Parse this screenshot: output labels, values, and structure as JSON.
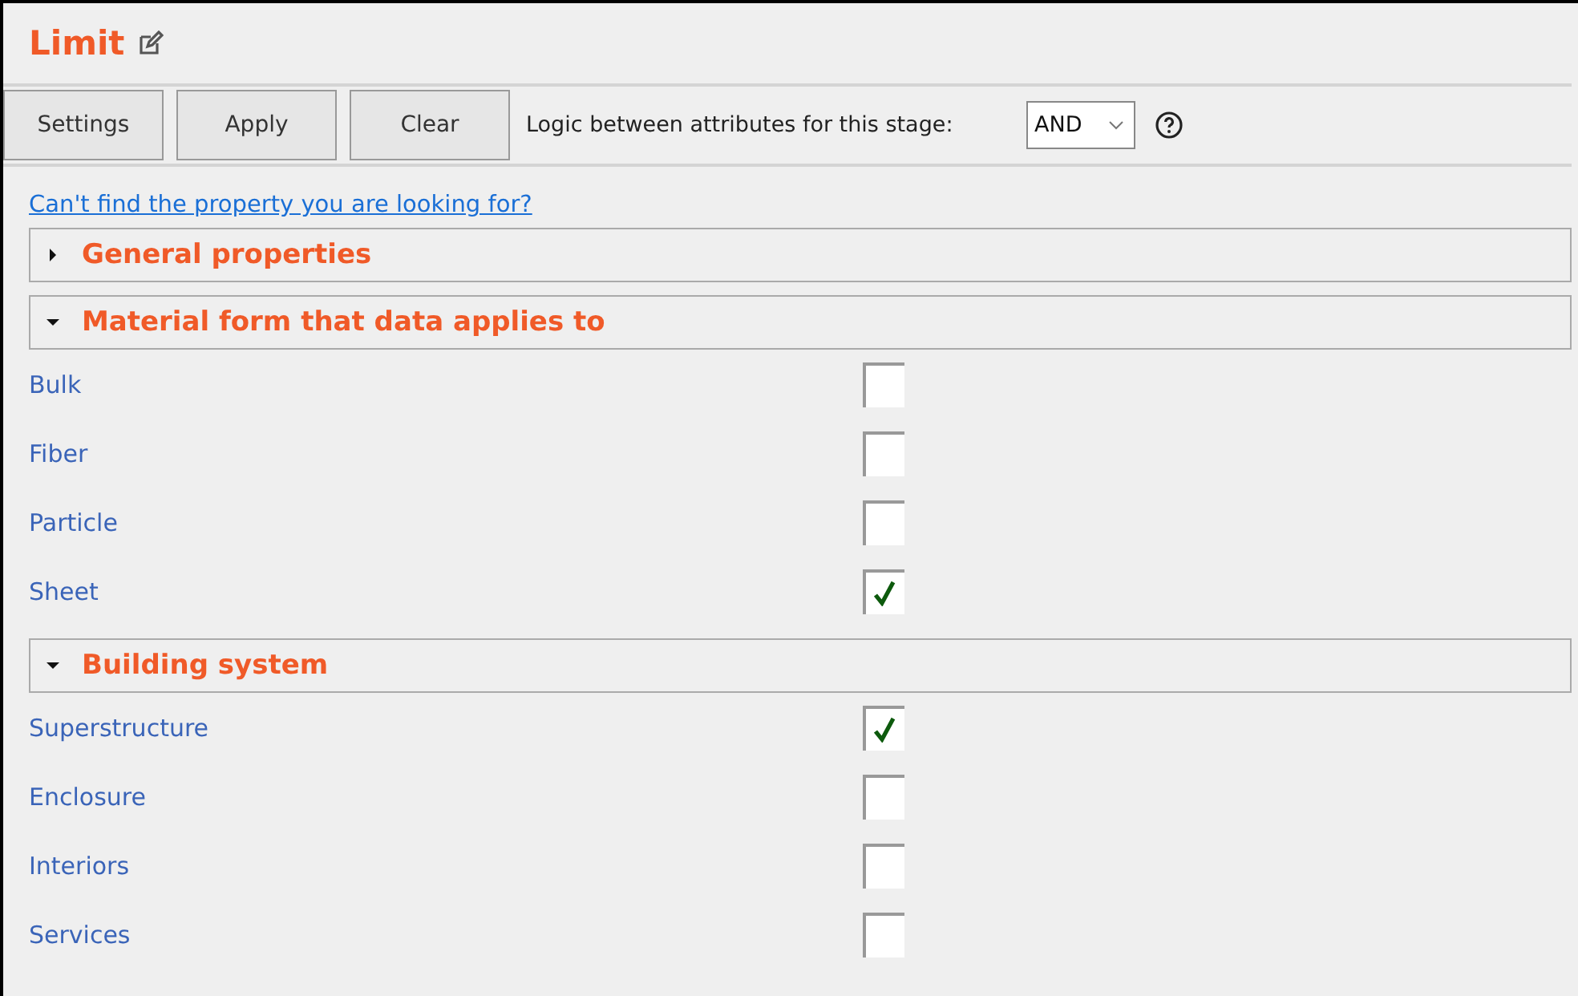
{
  "title": "Limit",
  "toolbar": {
    "buttons": [
      "Settings",
      "Apply",
      "Clear"
    ],
    "logic_label": "Logic between attributes for this stage:",
    "logic_value": "AND"
  },
  "help_link": "Can't find the property you are looking for?",
  "sections": [
    {
      "title": "General properties",
      "expanded": false
    },
    {
      "title": "Material form that data applies to",
      "expanded": true,
      "items": [
        {
          "label": "Bulk",
          "checked": false
        },
        {
          "label": "Fiber",
          "checked": false
        },
        {
          "label": "Particle",
          "checked": false
        },
        {
          "label": "Sheet",
          "checked": true
        }
      ]
    },
    {
      "title": "Building system",
      "expanded": true,
      "items": [
        {
          "label": "Superstructure",
          "checked": true
        },
        {
          "label": "Enclosure",
          "checked": false
        },
        {
          "label": "Interiors",
          "checked": false
        },
        {
          "label": "Services",
          "checked": false
        }
      ]
    }
  ]
}
